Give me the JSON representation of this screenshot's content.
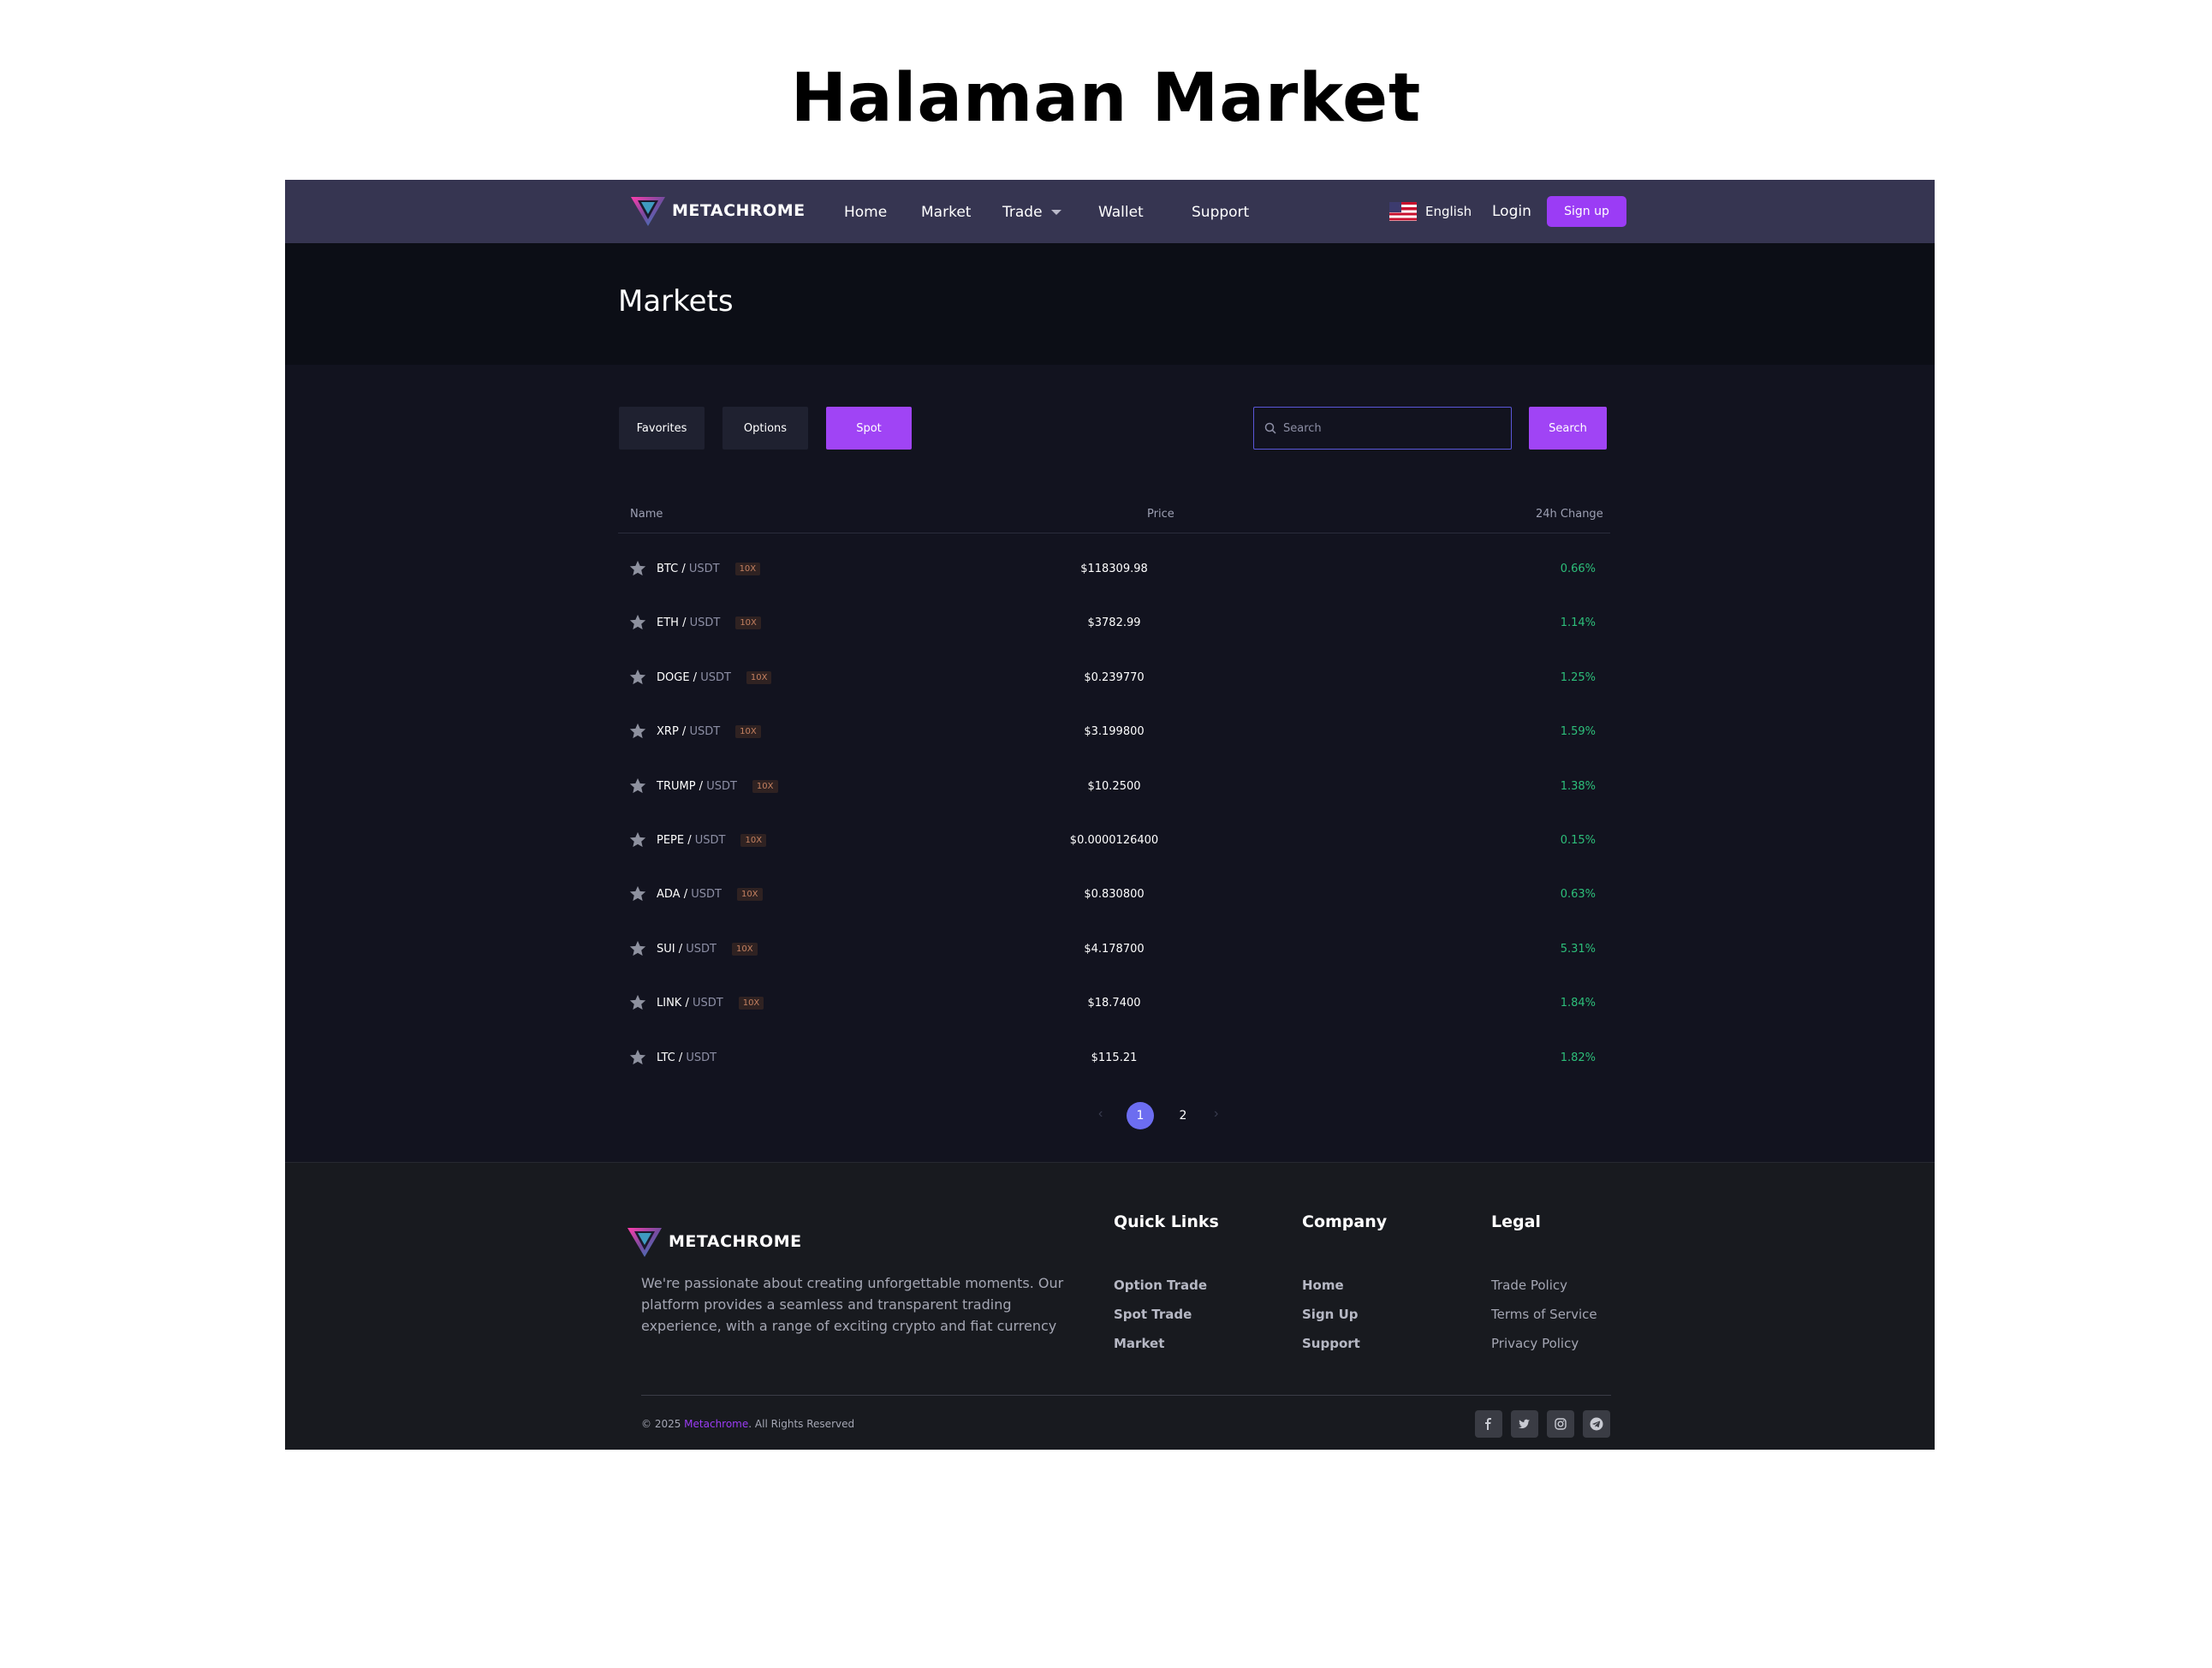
{
  "title": "Halaman Market",
  "nav": {
    "brand": "METACHROME",
    "links": [
      "Home",
      "Market",
      "Trade",
      "Wallet",
      "Support"
    ],
    "language": "English",
    "login": "Login",
    "signup": "Sign up"
  },
  "page_heading": "Markets",
  "filters": {
    "tabs": [
      "Favorites",
      "Options",
      "Spot"
    ],
    "active_tab": "Spot",
    "search_placeholder": "Search",
    "search_button": "Search"
  },
  "table": {
    "headers": [
      "Name",
      "Price",
      "24h Change"
    ],
    "rows": [
      {
        "base": "BTC",
        "quote": "USDT",
        "leverage": "10X",
        "price": "$118309.98",
        "change": "0.66%"
      },
      {
        "base": "ETH",
        "quote": "USDT",
        "leverage": "10X",
        "price": "$3782.99",
        "change": "1.14%"
      },
      {
        "base": "DOGE",
        "quote": "USDT",
        "leverage": "10X",
        "price": "$0.239770",
        "change": "1.25%"
      },
      {
        "base": "XRP",
        "quote": "USDT",
        "leverage": "10X",
        "price": "$3.199800",
        "change": "1.59%"
      },
      {
        "base": "TRUMP",
        "quote": "USDT",
        "leverage": "10X",
        "price": "$10.2500",
        "change": "1.38%"
      },
      {
        "base": "PEPE",
        "quote": "USDT",
        "leverage": "10X",
        "price": "$0.0000126400",
        "change": "0.15%"
      },
      {
        "base": "ADA",
        "quote": "USDT",
        "leverage": "10X",
        "price": "$0.830800",
        "change": "0.63%"
      },
      {
        "base": "SUI",
        "quote": "USDT",
        "leverage": "10X",
        "price": "$4.178700",
        "change": "5.31%"
      },
      {
        "base": "LINK",
        "quote": "USDT",
        "leverage": "10X",
        "price": "$18.7400",
        "change": "1.84%"
      },
      {
        "base": "LTC",
        "quote": "USDT",
        "leverage": "",
        "price": "$115.21",
        "change": "1.82%"
      }
    ]
  },
  "pagination": {
    "pages": [
      "1",
      "2"
    ],
    "current": "1",
    "prev": "‹",
    "next": "›"
  },
  "footer": {
    "brand": "METACHROME",
    "description": "We're passionate about creating unforgettable moments. Our platform provides a seamless and transparent trading experience, with a range of exciting crypto and fiat currency",
    "columns": [
      {
        "heading": "Quick Links",
        "links": [
          "Option Trade",
          "Spot Trade",
          "Market"
        ]
      },
      {
        "heading": "Company",
        "links": [
          "Home",
          "Sign Up",
          "Support"
        ]
      },
      {
        "heading": "Legal",
        "links": [
          "Trade Policy",
          "Terms of Service",
          "Privacy Policy"
        ]
      }
    ],
    "copyright_prefix": "© 2025 ",
    "copyright_brand": "Metachrome",
    "copyright_suffix": ". All Rights Reserved",
    "social": [
      "facebook-icon",
      "twitter-icon",
      "instagram-icon",
      "telegram-icon"
    ]
  },
  "colors": {
    "accent": "#a044f5",
    "positive": "#2dbf7a",
    "nav_bg": "#363551",
    "body_bg": "#12131f",
    "footer_bg": "#181a1f"
  }
}
